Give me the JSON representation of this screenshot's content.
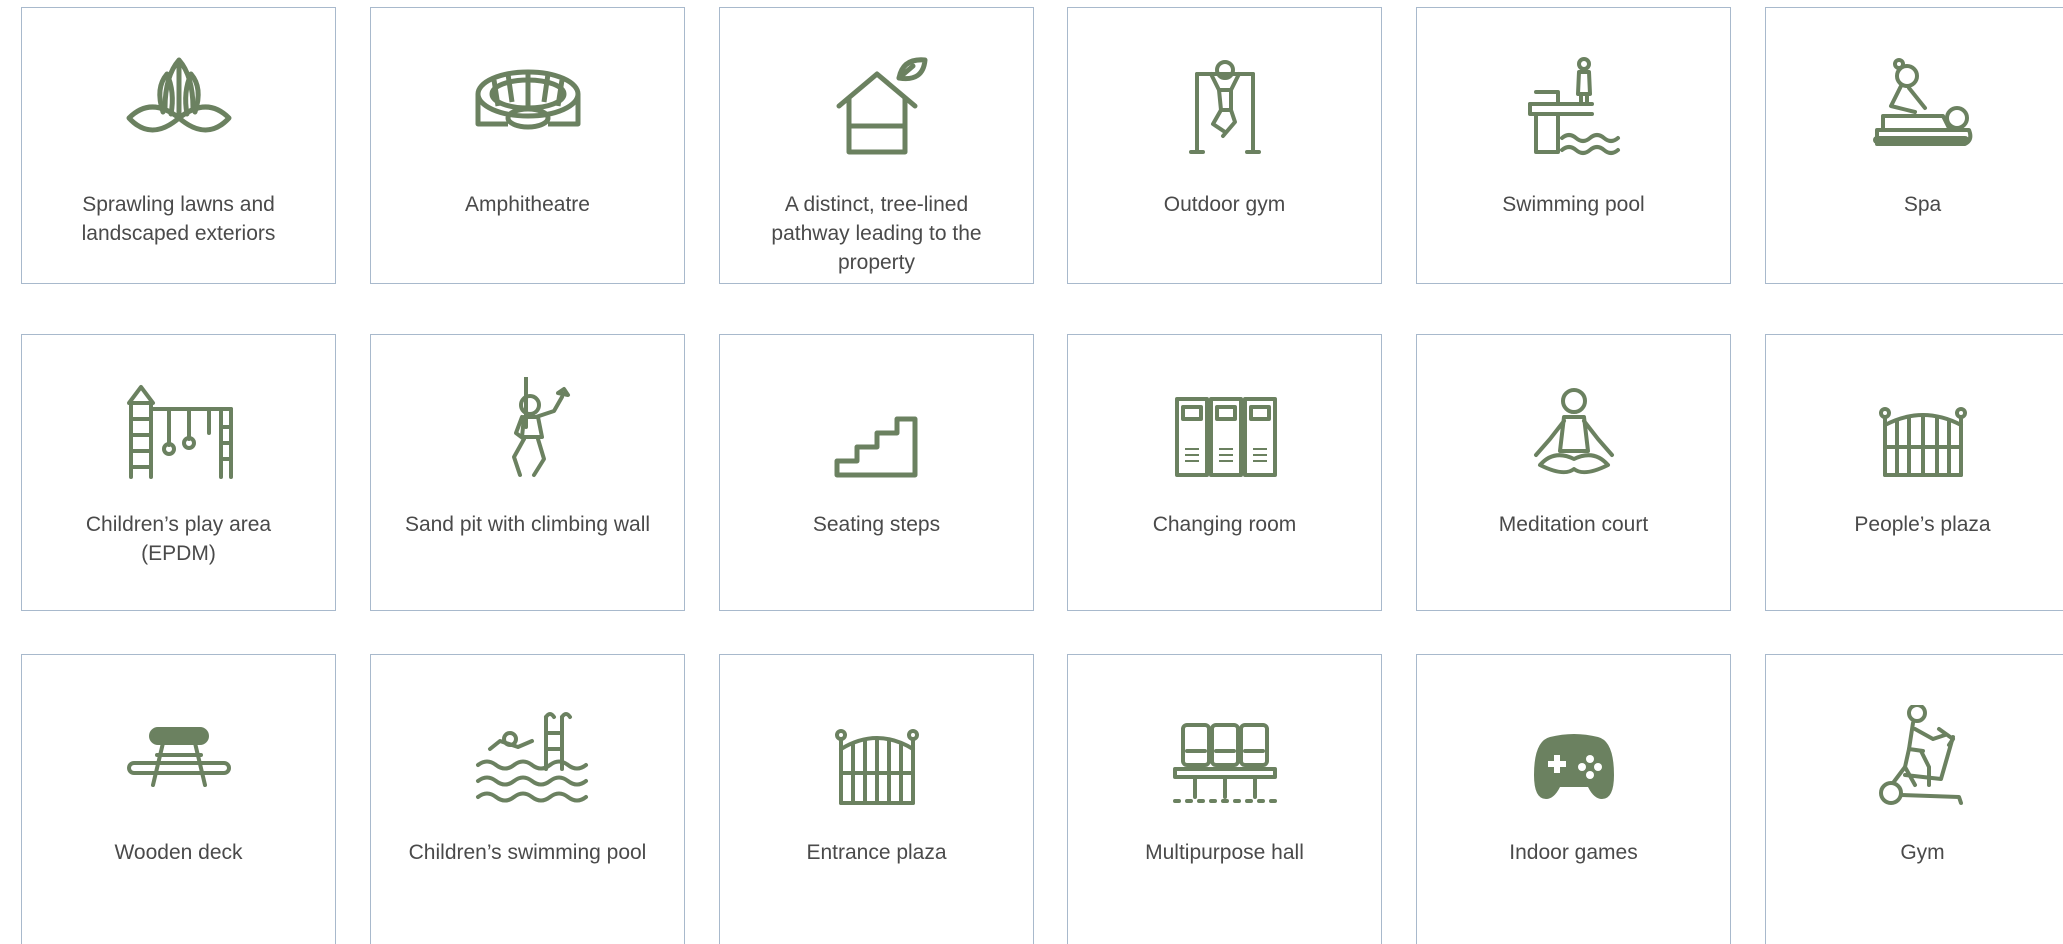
{
  "theme": {
    "icon_color": "#6b8160",
    "border_color": "#a8b9cc",
    "text_color": "#4a4a4a"
  },
  "amenities": [
    {
      "label": "Sprawling lawns and landscaped exteriors",
      "icon": "lawn-plant-icon"
    },
    {
      "label": "Amphitheatre",
      "icon": "amphitheatre-icon"
    },
    {
      "label": "A distinct, tree-lined pathway leading to the property",
      "icon": "eco-house-icon"
    },
    {
      "label": "Outdoor gym",
      "icon": "pull-up-bar-icon"
    },
    {
      "label": "Swimming pool",
      "icon": "diving-board-icon"
    },
    {
      "label": "Spa",
      "icon": "massage-icon"
    },
    {
      "label": "Children’s play area (EPDM)",
      "icon": "playground-icon"
    },
    {
      "label": "Sand pit with climbing wall",
      "icon": "climber-icon"
    },
    {
      "label": "Seating steps",
      "icon": "steps-icon"
    },
    {
      "label": "Changing room",
      "icon": "lockers-icon"
    },
    {
      "label": "Meditation court",
      "icon": "meditation-icon"
    },
    {
      "label": "People’s plaza",
      "icon": "gate-icon"
    },
    {
      "label": "Wooden deck",
      "icon": "picnic-table-icon"
    },
    {
      "label": "Children’s swimming pool",
      "icon": "swimmer-icon"
    },
    {
      "label": "Entrance plaza",
      "icon": "entrance-gate-icon"
    },
    {
      "label": "Multipurpose hall",
      "icon": "hall-seats-icon"
    },
    {
      "label": "Indoor games",
      "icon": "gamepad-icon"
    },
    {
      "label": "Gym",
      "icon": "elliptical-trainer-icon"
    }
  ]
}
